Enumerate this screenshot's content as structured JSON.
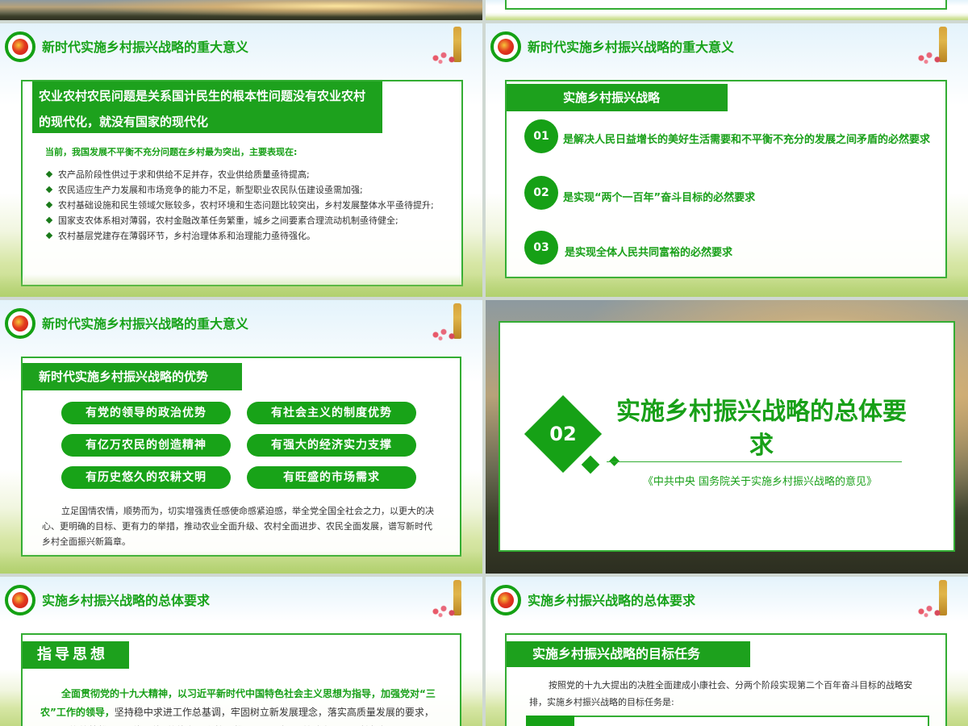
{
  "slide_a": {
    "title": "新时代实施乡村振兴战略的重大意义",
    "headline": "农业农村农民问题是关系国计民生的根本性问题没有农业农村的现代化，就没有国家的现代化",
    "intro": "当前，我国发展不平衡不充分问题在乡村最为突出，主要表现在:",
    "bullets": [
      "农产品阶段性供过于求和供给不足并存，农业供给质量亟待提高;",
      "农民适应生产力发展和市场竞争的能力不足，新型职业农民队伍建设亟需加强;",
      "农村基础设施和民生领域欠账较多，农村环境和生态问题比较突出，乡村发展整体水平亟待提升;",
      "国家支农体系相对薄弱，农村金融改革任务繁重，城乡之间要素合理流动机制亟待健全;",
      "农村基层党建存在薄弱环节，乡村治理体系和治理能力亟待强化。"
    ]
  },
  "slide_b": {
    "title": "新时代实施乡村振兴战略的重大意义",
    "section": "实施乡村振兴战略",
    "items": [
      {
        "num": "01",
        "text": "是解决人民日益增长的美好生活需要和不平衡不充分的发展之间矛盾的必然要求"
      },
      {
        "num": "02",
        "text": "是实现“两个一百年”奋斗目标的必然要求"
      },
      {
        "num": "03",
        "text": "是实现全体人民共同富裕的必然要求"
      }
    ]
  },
  "slide_c": {
    "title": "新时代实施乡村振兴战略的重大意义",
    "section": "新时代实施乡村振兴战略的优势",
    "pills": [
      "有党的领导的政治优势",
      "有社会主义的制度优势",
      "有亿万农民的创造精神",
      "有强大的经济实力支撑",
      "有历史悠久的农耕文明",
      "有旺盛的市场需求"
    ],
    "paragraph": "立足国情农情，顺势而为，切实增强责任感使命感紧迫感，举全党全国全社会之力，以更大的决心、更明确的目标、更有力的举措，推动农业全面升级、农村全面进步、农民全面发展，谱写新时代乡村全面振兴新篇章。"
  },
  "slide_d": {
    "number": "02",
    "title": "实施乡村振兴战略的总体要求",
    "subtitle": "《中共中央 国务院关于实施乡村振兴战略的意见》"
  },
  "slide_e": {
    "title": "实施乡村振兴战略的总体要求",
    "section": "指导思想",
    "text_bold": "全面贯彻党的十九大精神，以习近平新时代中国特色社会主义思想为指导，加强党对“三农”工作的领导，",
    "text_rest": "坚持稳中求进工作总基调，牢固树立新发展理念，落实高质量发展的要求，紧紧围绕统筹推进“五位一体”总体布局和协调推进“四个全面”战略布局，坚持把解"
  },
  "slide_f": {
    "title": "实施乡村振兴战略的总体要求",
    "section": "实施乡村振兴战略的目标任务",
    "text": "按照党的十九大提出的决胜全面建成小康社会、分两个阶段实现第二个百年奋斗目标的战略安排，实施乡村振兴战略的目标任务是:"
  },
  "colors": {
    "accent_green": "#18a018",
    "frame_green": "#33ad33"
  }
}
